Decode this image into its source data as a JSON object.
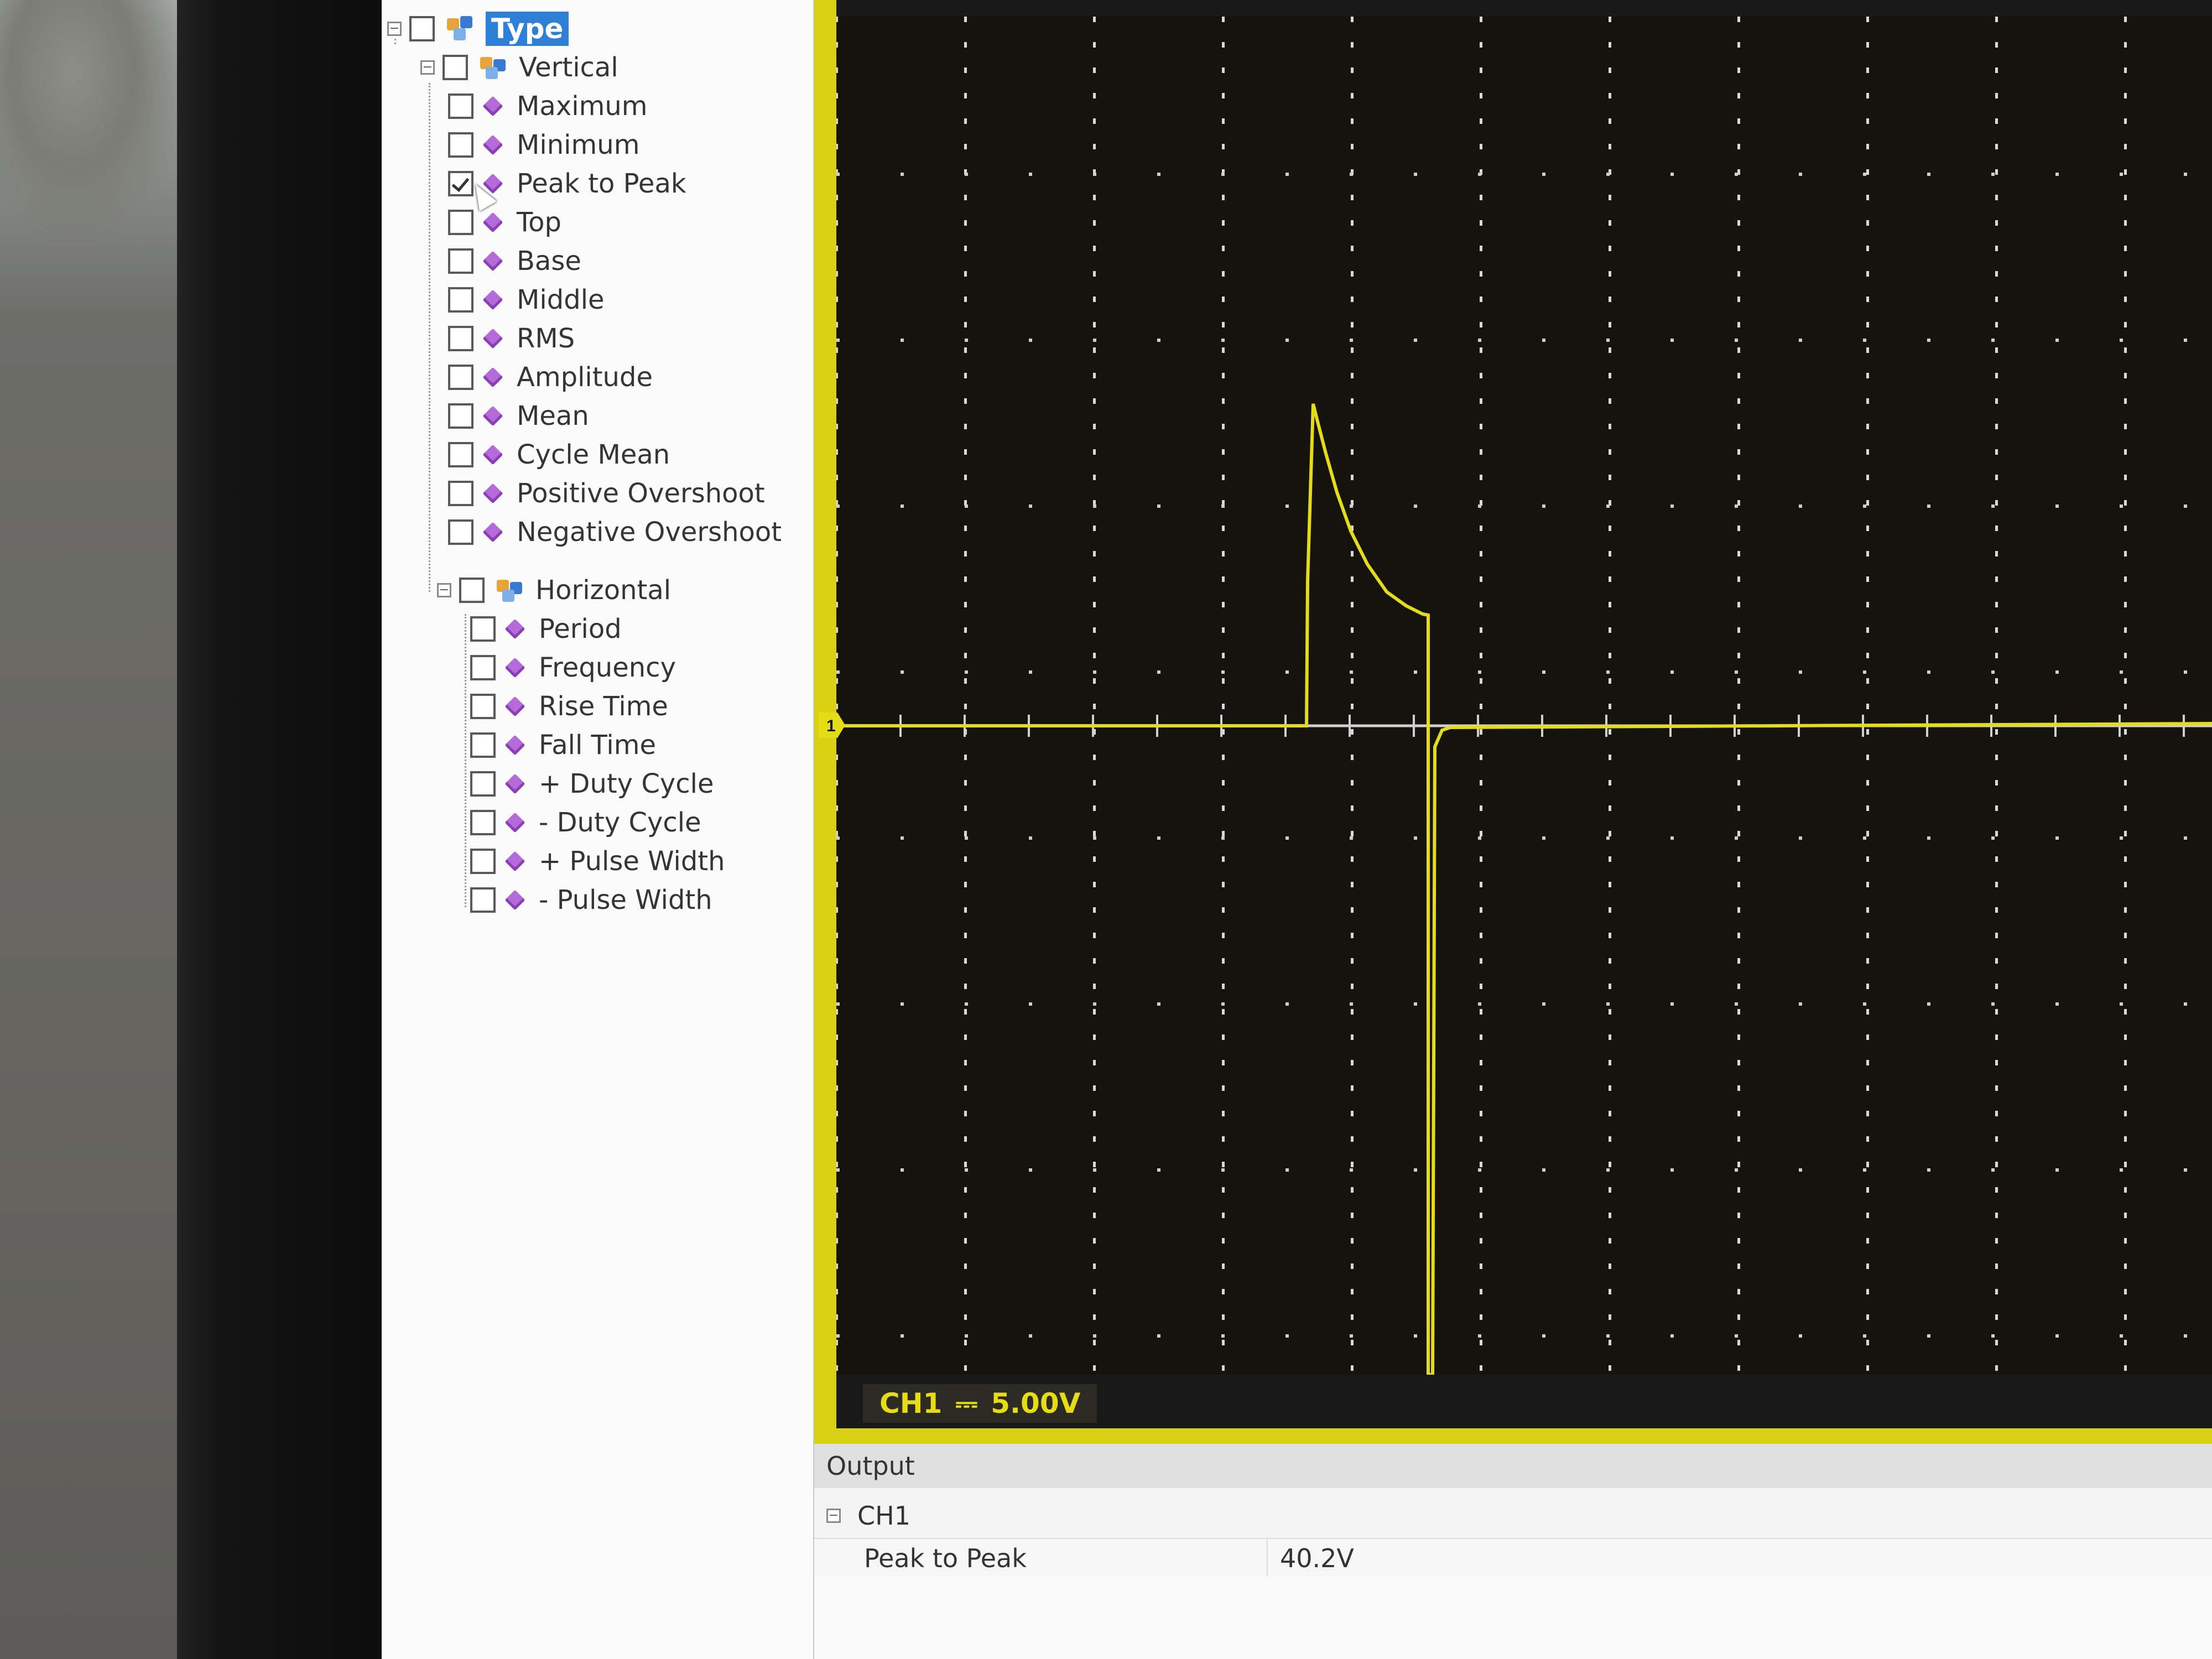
{
  "tree": {
    "root_label": "Type",
    "vertical": {
      "label": "Vertical",
      "items": [
        {
          "label": "Maximum",
          "checked": false
        },
        {
          "label": "Minimum",
          "checked": false
        },
        {
          "label": "Peak to Peak",
          "checked": true
        },
        {
          "label": "Top",
          "checked": false
        },
        {
          "label": "Base",
          "checked": false
        },
        {
          "label": "Middle",
          "checked": false
        },
        {
          "label": "RMS",
          "checked": false
        },
        {
          "label": "Amplitude",
          "checked": false
        },
        {
          "label": "Mean",
          "checked": false
        },
        {
          "label": "Cycle Mean",
          "checked": false
        },
        {
          "label": "Positive Overshoot",
          "checked": false
        },
        {
          "label": "Negative Overshoot",
          "checked": false
        }
      ]
    },
    "horizontal": {
      "label": "Horizontal",
      "items": [
        {
          "label": "Period",
          "checked": false
        },
        {
          "label": "Frequency",
          "checked": false
        },
        {
          "label": "Rise Time",
          "checked": false
        },
        {
          "label": "Fall Time",
          "checked": false
        },
        {
          "label": "+ Duty Cycle",
          "checked": false
        },
        {
          "label": "- Duty Cycle",
          "checked": false
        },
        {
          "label": "+ Pulse Width",
          "checked": false
        },
        {
          "label": "- Pulse Width",
          "checked": false
        }
      ]
    }
  },
  "scope": {
    "channel_marker": "1",
    "channel_label": "CH1",
    "coupling_symbol": "⎓",
    "volts_per_div": "5.00V",
    "trace_color": "#e6dc16"
  },
  "output": {
    "header": "Output",
    "channel": "CH1",
    "measurement_name": "Peak to Peak",
    "measurement_value": "40.2V"
  }
}
